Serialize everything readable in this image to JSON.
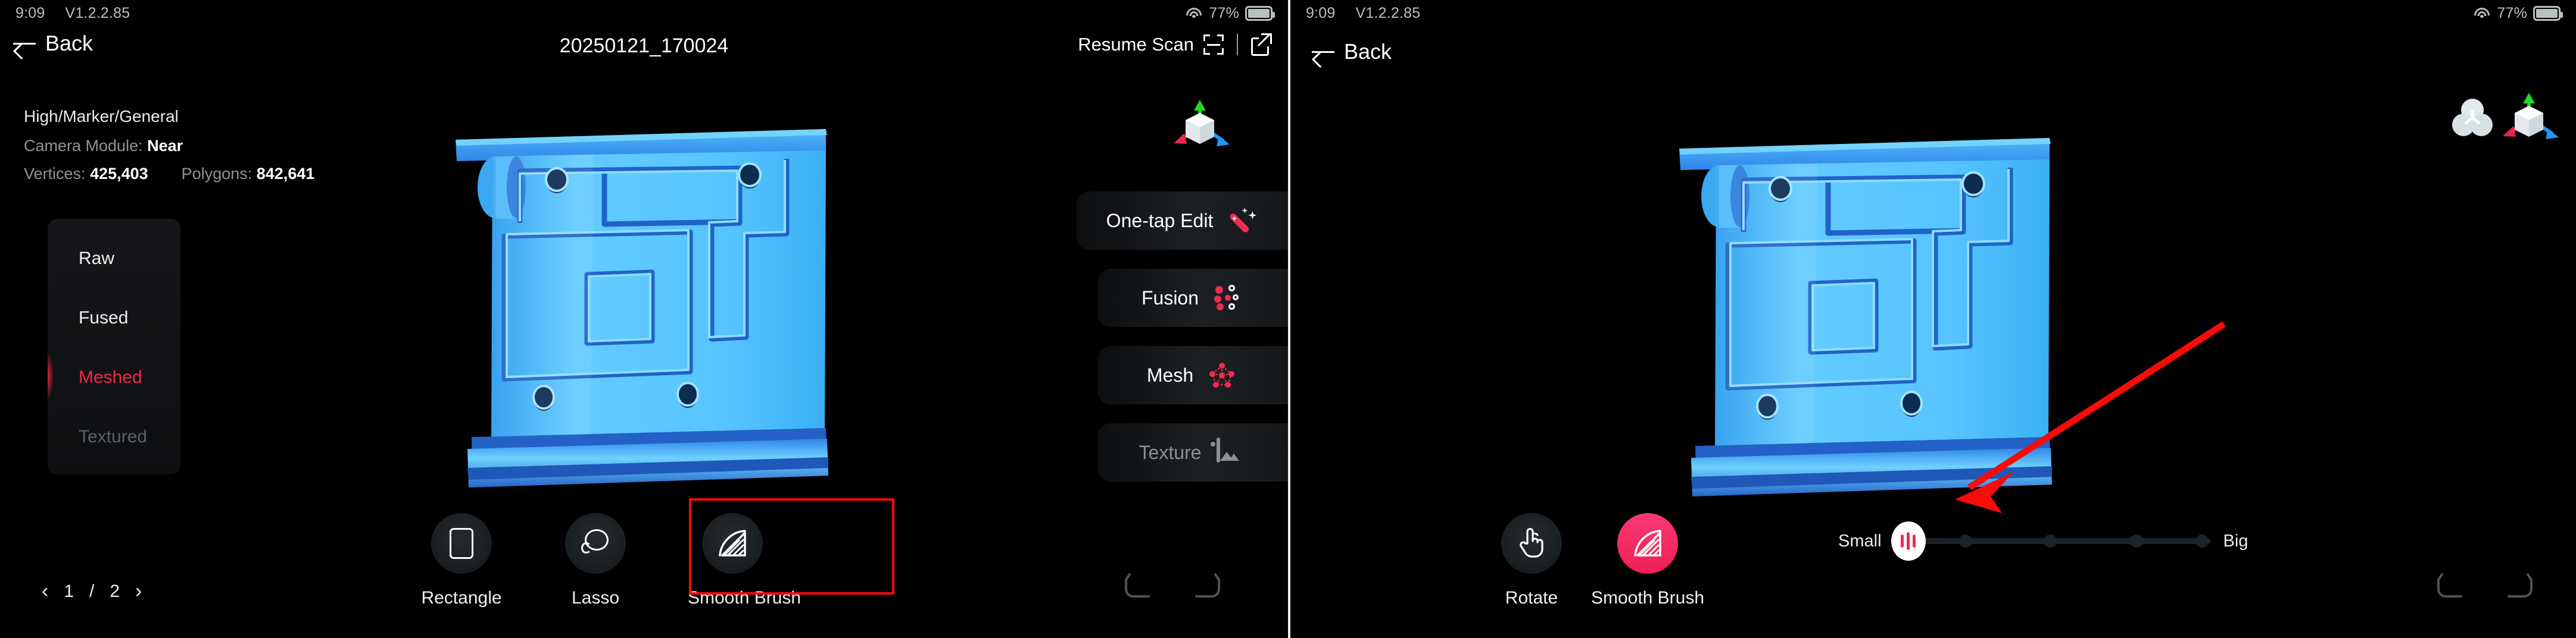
{
  "app": {
    "accent_red": "#f3274c",
    "accent_pink": "#ee1f55",
    "annotation_red": "#fc0a0a",
    "model_cyan": "#3fb9ff"
  },
  "left_pane": {
    "statusbar": {
      "time": "9:09",
      "version": "V1.2.2.85",
      "battery_percent": "77%",
      "wifi_icon": "wifi-icon",
      "battery_icon": "battery-icon"
    },
    "topbar": {
      "back_label": "Back",
      "back_icon": "arrow-left-icon",
      "title": "20250121_170024",
      "resume_scan_label": "Resume Scan",
      "scan_icon": "scan-frame-icon",
      "share_icon": "share-export-icon"
    },
    "scan_meta": {
      "profile": "High/Marker/General",
      "camera_module_label": "Camera Module:",
      "camera_module_value": "Near",
      "vertices_label": "Vertices:",
      "vertices_value": "425,403",
      "polygons_label": "Polygons:",
      "polygons_value": "842,641"
    },
    "stages": [
      {
        "label": "Raw",
        "state": "normal"
      },
      {
        "label": "Fused",
        "state": "normal"
      },
      {
        "label": "Meshed",
        "state": "active"
      },
      {
        "label": "Textured",
        "state": "disabled"
      }
    ],
    "pager": {
      "prev_icon": "chevron-left-icon",
      "next_icon": "chevron-right-icon",
      "current": "1",
      "separator": "/",
      "total": "2"
    },
    "actions": [
      {
        "label": "One-tap Edit",
        "icon": "magic-wand-icon",
        "state": "normal"
      },
      {
        "label": "Fusion",
        "icon": "fusion-dots-icon",
        "state": "normal"
      },
      {
        "label": "Mesh",
        "icon": "mesh-network-icon",
        "state": "normal"
      },
      {
        "label": "Texture",
        "icon": "image-texture-icon",
        "state": "disabled"
      }
    ],
    "tools": [
      {
        "label": "Rectangle",
        "icon": "rectangle-select-icon",
        "state": "normal"
      },
      {
        "label": "Lasso",
        "icon": "lasso-select-icon",
        "state": "normal"
      },
      {
        "label": "Smooth Brush",
        "icon": "smooth-brush-icon",
        "state": "highlighted"
      }
    ],
    "history": {
      "undo_icon": "undo-arrow-icon",
      "redo_icon": "redo-arrow-icon"
    },
    "gizmo_icon": "axis-gizmo-icon"
  },
  "right_pane": {
    "statusbar": {
      "time": "9:09",
      "version": "V1.2.2.85",
      "battery_percent": "77%",
      "wifi_icon": "wifi-icon",
      "battery_icon": "battery-icon"
    },
    "topbar": {
      "back_label": "Back",
      "back_icon": "arrow-left-icon"
    },
    "viewport_icons": {
      "spheres_icon": "three-spheres-icon",
      "gizmo_icon": "axis-gizmo-icon"
    },
    "tools": [
      {
        "label": "Rotate",
        "icon": "hand-pointer-icon",
        "state": "normal"
      },
      {
        "label": "Smooth Brush",
        "icon": "smooth-brush-icon",
        "state": "active"
      }
    ],
    "brush_slider": {
      "min_label": "Small",
      "max_label": "Big",
      "thumb_icon": "brush-size-thumb-icon",
      "value_index": 0,
      "tick_count": 4
    },
    "history": {
      "undo_icon": "undo-arrow-icon",
      "redo_icon": "redo-arrow-icon"
    },
    "annotation": {
      "arrow_icon": "red-pointer-arrow"
    }
  }
}
